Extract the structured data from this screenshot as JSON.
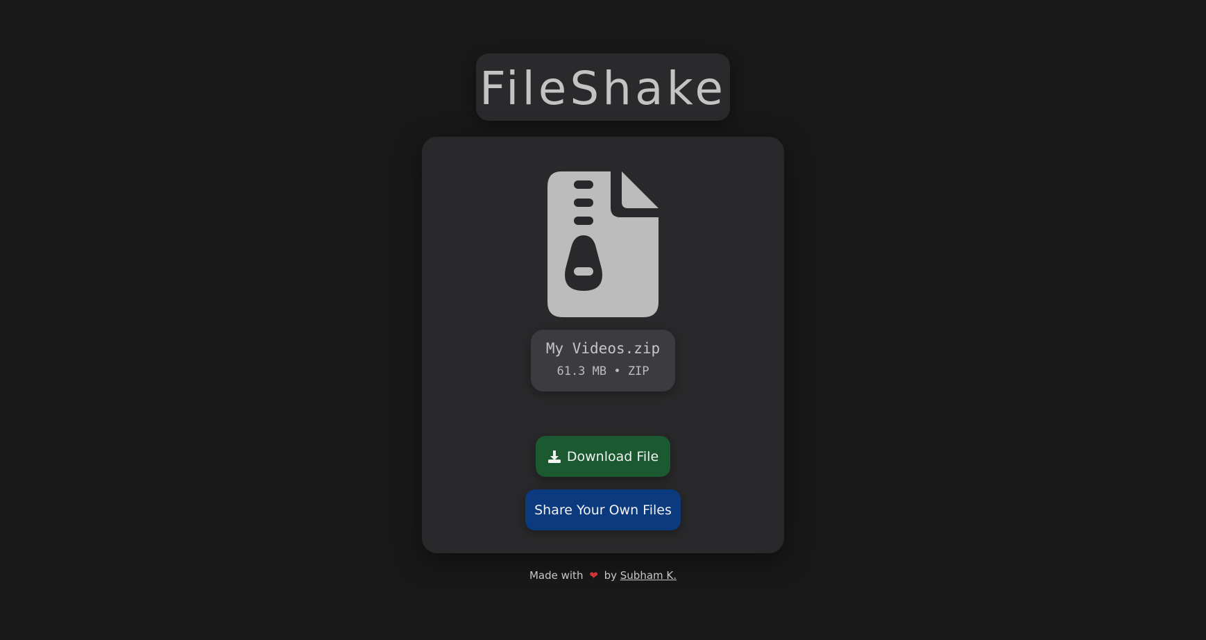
{
  "brand": {
    "title": "FileShake"
  },
  "file": {
    "icon": "file-zipper-icon",
    "name": "My Videos.zip",
    "meta": "61.3 MB • ZIP"
  },
  "actions": {
    "download_label": "Download File",
    "download_icon": "download-icon",
    "share_label": "Share Your Own Files"
  },
  "footer": {
    "made_with": "Made with",
    "heart": "❤",
    "by": "by",
    "author": "Subham K."
  },
  "colors": {
    "background": "#191919",
    "card": "#29292b",
    "download_button": "#1b5930",
    "share_button": "#0b3a7e",
    "heart": "#d2343c"
  }
}
